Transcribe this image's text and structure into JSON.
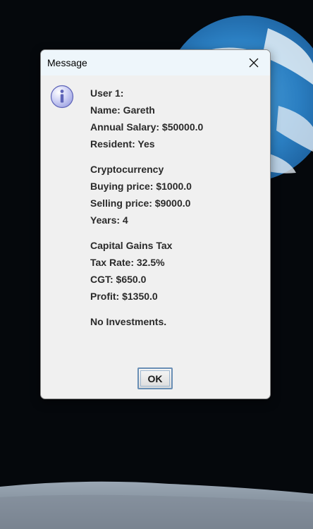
{
  "dialog": {
    "title": "Message",
    "icon": "info-icon",
    "user_block": [
      "User 1:",
      "Name: Gareth",
      "Annual Salary: $50000.0",
      "Resident: Yes"
    ],
    "crypto_block": [
      "Cryptocurrency",
      "Buying price: $1000.0",
      "Selling price: $9000.0",
      "Years: 4"
    ],
    "tax_block": [
      "Capital Gains Tax",
      "Tax Rate: 32.5%",
      "CGT: $650.0",
      "Profit: $1350.0"
    ],
    "footer_text": "No Investments.",
    "ok_label": "OK"
  }
}
